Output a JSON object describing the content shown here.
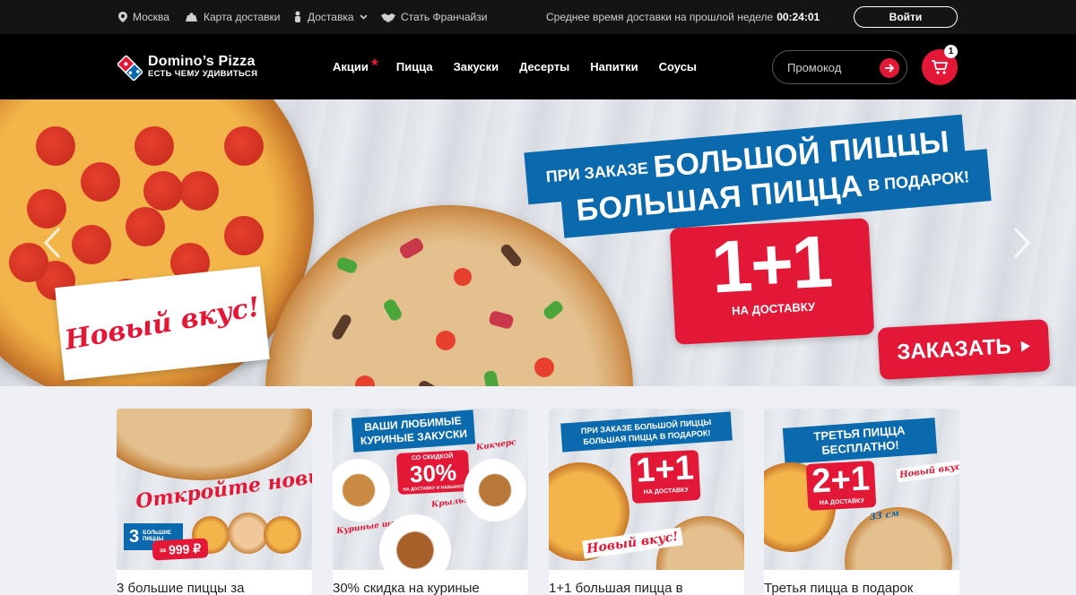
{
  "topbar": {
    "city": "Москва",
    "delivery_map": "Карта доставки",
    "delivery": "Доставка",
    "franchise": "Стать Франчайзи",
    "avg_time_label": "Среднее время доставки на прошлой неделе",
    "avg_time_value": "00:24:01",
    "login": "Войти"
  },
  "nav": {
    "brand": "Domino’s Pizza",
    "tagline": "ЕСТЬ ЧЕМУ УДИВИТЬСЯ",
    "items": [
      "Акции",
      "Пицца",
      "Закуски",
      "Десерты",
      "Напитки",
      "Соусы"
    ],
    "promo_placeholder": "Промокод",
    "cart_count": "1"
  },
  "hero": {
    "new_taste": "Новый вкус!",
    "line1_small": "ПРИ ЗАКАЗЕ",
    "line1_big": "БОЛЬШОЙ ПИЦЦЫ",
    "line2_big": "БОЛЬШАЯ ПИЦЦА",
    "line2_small": "В ПОДАРОК!",
    "offer": "1+1",
    "offer_sub": "НА ДОСТАВКУ",
    "order_button": "ЗАКАЗАТЬ"
  },
  "cards": [
    {
      "title": "3 большие пиццы за",
      "script": "Откройте новый вкус!",
      "badge_number": "3",
      "badge_text": "БОЛЬШИЕ ПИЦЦЫ",
      "price_prefix": "за",
      "price": "999 ₽"
    },
    {
      "title": "30% скидка на куриные",
      "banner_line1": "ВАШИ ЛЮБИМЫЕ",
      "banner_line2": "КУРИНЫЕ ЗАКУСКИ",
      "discount_top": "СО СКИДКОЙ",
      "discount": "30%",
      "discount_sub": "НА ДОСТАВКУ И НАВЫНОС",
      "label_a": "Кикчерс",
      "label_b": "Куриные шарики",
      "label_c": "Крылья"
    },
    {
      "title": "1+1 большая пицца в",
      "banner_line1": "ПРИ ЗАКАЗЕ БОЛЬШОЙ ПИЦЦЫ",
      "banner_line2": "БОЛЬШАЯ ПИЦЦА В ПОДАРОК!",
      "offer": "1+1",
      "offer_sub": "НА ДОСТАВКУ",
      "script": "Новый вкус!"
    },
    {
      "title": "Третья пицца в подарок",
      "banner_line1": "ТРЕТЬЯ ПИЦЦА",
      "banner_line2": "БЕСПЛАТНО!",
      "offer": "2+1",
      "offer_sub": "НА ДОСТАВКУ",
      "script": "Новый вкус!",
      "size": "33 см"
    }
  ],
  "colors": {
    "brand_red": "#e31837",
    "brand_blue": "#0b6aae",
    "topbar_bg": "#141414",
    "nav_bg": "#000000",
    "page_bg": "#eef0f5"
  },
  "icons": [
    "location-pin-icon",
    "map-icon",
    "delivery-icon",
    "chevron-down-icon",
    "handshake-icon",
    "arrow-right-icon",
    "cart-icon",
    "chevron-left-icon",
    "chevron-right-icon",
    "play-triangle-icon"
  ]
}
